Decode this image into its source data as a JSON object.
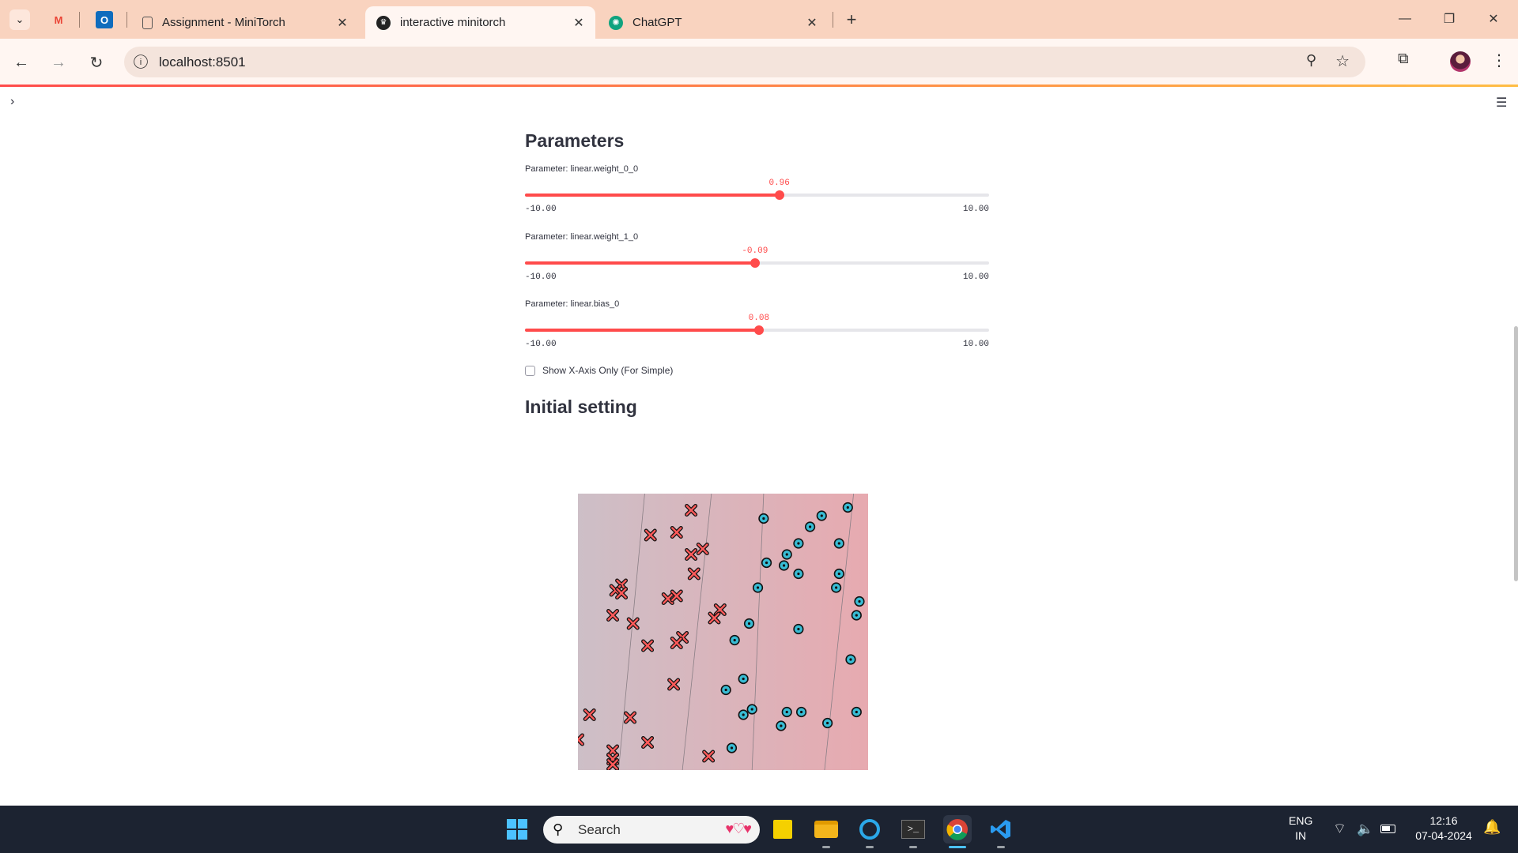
{
  "browser": {
    "tabs": [
      {
        "title": "Assignment - MiniTorch",
        "active": false
      },
      {
        "title": "interactive minitorch",
        "active": true
      },
      {
        "title": "ChatGPT",
        "active": false
      }
    ],
    "url": "localhost:8501"
  },
  "page": {
    "heading_parameters": "Parameters",
    "sliders": [
      {
        "label": "Parameter: linear.weight_0_0",
        "value": "0.96",
        "numeric": 0.96,
        "min": "-10.00",
        "max": "10.00"
      },
      {
        "label": "Parameter: linear.weight_1_0",
        "value": "-0.09",
        "numeric": -0.09,
        "min": "-10.00",
        "max": "10.00"
      },
      {
        "label": "Parameter: linear.bias_0",
        "value": "0.08",
        "numeric": 0.08,
        "min": "-10.00",
        "max": "10.00"
      }
    ],
    "checkbox_label": "Show X-Axis Only (For Simple)",
    "checkbox_checked": false,
    "heading_initial": "Initial setting"
  },
  "chart_data": {
    "type": "scatter",
    "xlim": [
      0,
      1
    ],
    "ylim": [
      0,
      1
    ],
    "contour_lines": [
      [
        [
          0.23,
          1.0
        ],
        [
          0.14,
          0.0
        ]
      ],
      [
        [
          0.46,
          1.0
        ],
        [
          0.36,
          0.0
        ]
      ],
      [
        [
          0.64,
          1.0
        ],
        [
          0.6,
          0.0
        ]
      ],
      [
        [
          0.95,
          1.0
        ],
        [
          0.85,
          0.0
        ]
      ]
    ],
    "series": [
      {
        "marker": "x",
        "color": "#ff5a5a",
        "points": [
          [
            0.39,
            0.94
          ],
          [
            0.25,
            0.85
          ],
          [
            0.34,
            0.86
          ],
          [
            0.39,
            0.78
          ],
          [
            0.43,
            0.8
          ],
          [
            0.4,
            0.71
          ],
          [
            0.15,
            0.67
          ],
          [
            0.13,
            0.65
          ],
          [
            0.15,
            0.64
          ],
          [
            0.31,
            0.62
          ],
          [
            0.34,
            0.63
          ],
          [
            0.49,
            0.58
          ],
          [
            0.47,
            0.55
          ],
          [
            0.12,
            0.56
          ],
          [
            0.19,
            0.53
          ],
          [
            0.36,
            0.48
          ],
          [
            0.34,
            0.46
          ],
          [
            0.24,
            0.45
          ],
          [
            0.33,
            0.31
          ],
          [
            0.04,
            0.2
          ],
          [
            0.18,
            0.19
          ],
          [
            0.0,
            0.11
          ],
          [
            0.24,
            0.1
          ],
          [
            0.12,
            0.07
          ],
          [
            0.12,
            0.04
          ],
          [
            0.12,
            0.02
          ],
          [
            0.45,
            0.05
          ]
        ]
      },
      {
        "marker": "o",
        "color": "#38bcd4",
        "points": [
          [
            0.93,
            0.95
          ],
          [
            0.84,
            0.92
          ],
          [
            0.8,
            0.88
          ],
          [
            0.64,
            0.91
          ],
          [
            0.76,
            0.82
          ],
          [
            0.9,
            0.82
          ],
          [
            0.72,
            0.78
          ],
          [
            0.65,
            0.75
          ],
          [
            0.71,
            0.74
          ],
          [
            0.9,
            0.71
          ],
          [
            0.76,
            0.71
          ],
          [
            0.62,
            0.66
          ],
          [
            0.89,
            0.66
          ],
          [
            0.97,
            0.61
          ],
          [
            0.96,
            0.56
          ],
          [
            0.59,
            0.53
          ],
          [
            0.54,
            0.47
          ],
          [
            0.76,
            0.51
          ],
          [
            0.94,
            0.4
          ],
          [
            0.57,
            0.33
          ],
          [
            0.51,
            0.29
          ],
          [
            0.6,
            0.22
          ],
          [
            0.57,
            0.2
          ],
          [
            0.72,
            0.21
          ],
          [
            0.77,
            0.21
          ],
          [
            0.7,
            0.16
          ],
          [
            0.86,
            0.17
          ],
          [
            0.96,
            0.21
          ],
          [
            0.53,
            0.08
          ]
        ]
      }
    ]
  },
  "taskbar": {
    "search_placeholder": "Search",
    "lang": "ENG",
    "region": "IN",
    "time": "12:16",
    "date": "07-04-2024"
  }
}
